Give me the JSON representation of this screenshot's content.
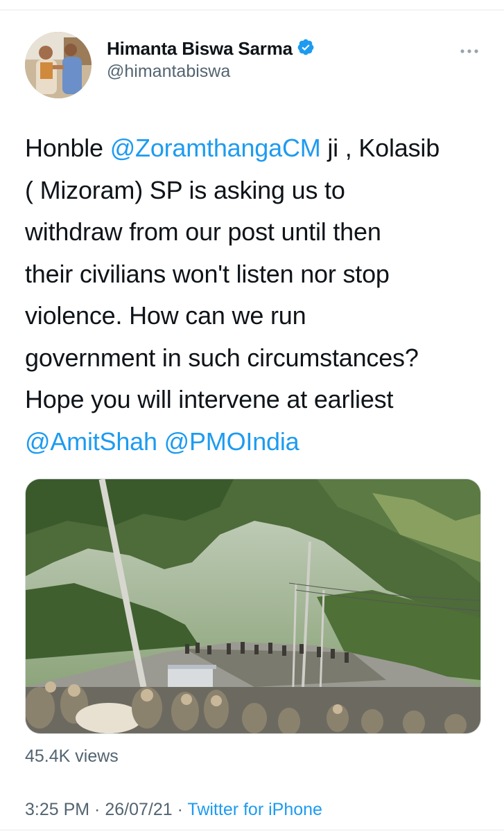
{
  "author": {
    "display_name": "Himanta Biswa Sarma",
    "handle": "@himantabiswa",
    "verified": true
  },
  "tweet": {
    "lines": [
      [
        {
          "text": "Honble "
        },
        {
          "text": "@ZoramthangaCM",
          "mention": true
        },
        {
          "text": " ji , Kolasib"
        }
      ],
      [
        {
          "text": "( Mizoram) SP is asking us to"
        }
      ],
      [
        {
          "text": "withdraw from our post until then"
        }
      ],
      [
        {
          "text": "their civilians won't listen nor stop"
        }
      ],
      [
        {
          "text": "violence. How can we run"
        }
      ],
      [
        {
          "text": "government in such circumstances?"
        }
      ],
      [
        {
          "text": "Hope you will intervene at earliest"
        }
      ],
      [
        {
          "text": "@AmitShah",
          "mention": true
        },
        {
          "text": " "
        },
        {
          "text": "@PMOIndia",
          "mention": true
        }
      ]
    ]
  },
  "stats": {
    "views": "45.4K views"
  },
  "meta": {
    "time": "3:25 PM",
    "separator": " · ",
    "date": "26/07/21",
    "source": "Twitter for iPhone"
  },
  "icons": {
    "verified": "verified-badge-icon",
    "more": "more-options-icon"
  },
  "colors": {
    "accent": "#1d9bf0",
    "secondary_text": "#536471"
  }
}
